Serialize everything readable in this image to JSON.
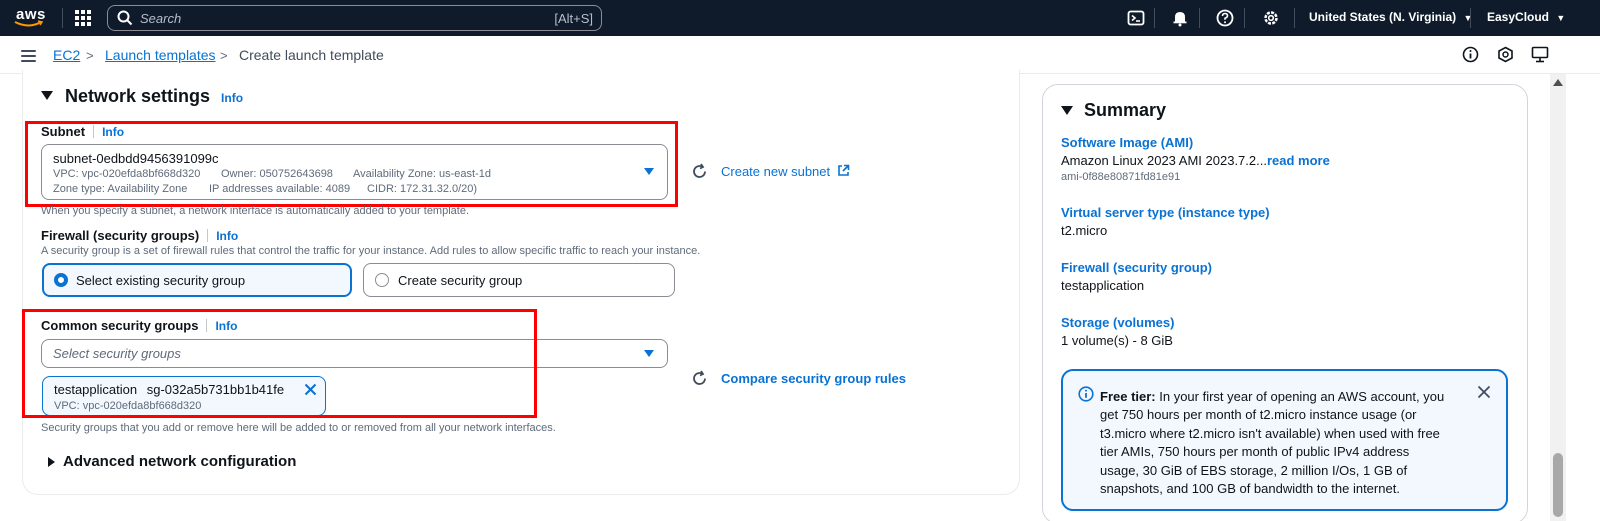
{
  "topnav": {
    "logo_text": "aws",
    "search_placeholder": "Search",
    "search_shortcut": "[Alt+S]",
    "region": "United States (N. Virginia)",
    "account": "EasyCloud"
  },
  "breadcrumb": {
    "items": [
      "EC2",
      "Launch templates",
      "Create launch template"
    ]
  },
  "network": {
    "title": "Network settings",
    "info": "Info",
    "subnet_label": "Subnet",
    "subnet_info": "Info",
    "subnet_id": "subnet-0edbdd9456391099c",
    "subnet_vpc": "VPC: vpc-020efda8bf668d320",
    "subnet_owner": "Owner: 050752643698",
    "subnet_az": "Availability Zone: us-east-1d",
    "subnet_zone_type": "Zone type: Availability Zone",
    "subnet_ips": "IP addresses available: 4089",
    "subnet_cidr": "CIDR: 172.31.32.0/20)",
    "create_subnet": "Create new subnet",
    "subnet_desc": "When you specify a subnet, a network interface is automatically added to your template.",
    "firewall_label": "Firewall (security groups)",
    "firewall_info": "Info",
    "firewall_desc": "A security group is a set of firewall rules that control the traffic for your instance. Add rules to allow specific traffic to reach your instance.",
    "option_existing": "Select existing security group",
    "option_create": "Create security group",
    "csg_label": "Common security groups",
    "csg_info": "Info",
    "csg_placeholder": "Select security groups",
    "compare_rules": "Compare security group rules",
    "token_name": "testapplication",
    "token_id": "sg-032a5b731bb1b41fe",
    "token_vpc": "VPC: vpc-020efda8bf668d320",
    "csg_desc": "Security groups that you add or remove here will be added to or removed from all your network interfaces.",
    "advanced": "Advanced network configuration"
  },
  "summary": {
    "title": "Summary",
    "ami_label": "Software Image (AMI)",
    "ami_value": "Amazon Linux 2023 AMI 2023.7.2...",
    "ami_read_more": "read more",
    "ami_id": "ami-0f88e80871fd81e91",
    "instance_label": "Virtual server type (instance type)",
    "instance_value": "t2.micro",
    "firewall_label": "Firewall (security group)",
    "firewall_value": "testapplication",
    "storage_label": "Storage (volumes)",
    "storage_value": "1 volume(s) - 8 GiB",
    "alert_title": "Free tier:",
    "alert_body": " In your first year of opening an AWS account, you get 750 hours per month of t2.micro instance usage (or t3.micro where t2.micro isn't available) when used with free tier AMIs, 750 hours per month of public IPv4 address usage, 30 GiB of EBS storage, 2 million I/Os, 1 GB of snapshots, and 100 GB of bandwidth to the internet."
  },
  "colors": {
    "accent": "#0972d3",
    "nav_bg": "#0f1b2a",
    "highlight": "#ff0000"
  }
}
